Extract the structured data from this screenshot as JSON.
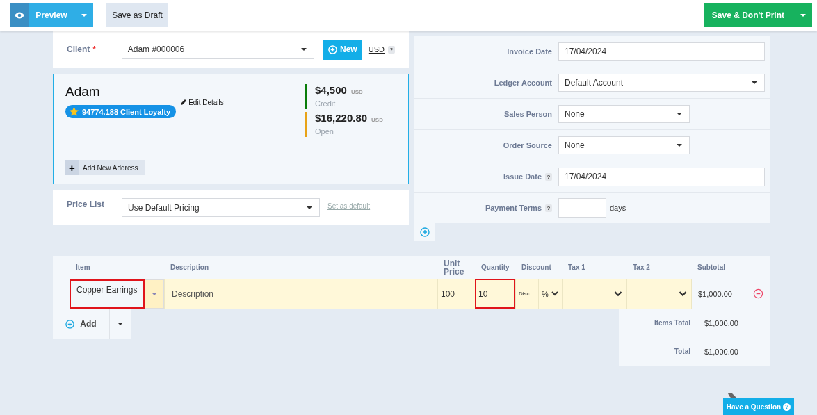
{
  "toolbar": {
    "preview_button": "Preview",
    "draft_button": "Save as Draft",
    "save_button": "Save & Don't Print"
  },
  "client": {
    "label": "Client",
    "required_mark": "*",
    "value": "Adam #000006",
    "new_button": "New",
    "currency": "USD",
    "currency_help": "?"
  },
  "client_card": {
    "name": "Adam",
    "edit_link": "Edit Details",
    "loyalty": "94774.188 Client Loyalty",
    "add_address_icon": "+",
    "add_address": "Add New Address",
    "balances": [
      {
        "amount": "$4,500",
        "currency": "USD",
        "label": "Credit",
        "color": "#0a7d0a"
      },
      {
        "amount": "$16,220.80",
        "currency": "USD",
        "label": "Open",
        "color": "#e8a317"
      }
    ]
  },
  "price_list": {
    "label": "Price List",
    "value": "Use Default Pricing",
    "link": "Set as default"
  },
  "fields": [
    {
      "label": "Invoice Date",
      "kind": "date",
      "value": "17/04/2024"
    },
    {
      "label": "Ledger Account",
      "kind": "account",
      "value": "Default Account"
    },
    {
      "label": "Sales Person",
      "kind": "select",
      "value": "None"
    },
    {
      "label": "Order Source",
      "kind": "select",
      "value": "None"
    },
    {
      "label": "Issue Date",
      "kind": "date",
      "value": "17/04/2024",
      "help": "?"
    },
    {
      "label": "Payment Terms",
      "kind": "number",
      "suffix": "days",
      "help": "?"
    }
  ],
  "items_table": {
    "columns": [
      "Item",
      "Description",
      "Unit Price",
      "Quantity",
      "Discount",
      "Tax 1",
      "Tax 2",
      "Subtotal"
    ],
    "rows": [
      {
        "item": "Copper Earrings",
        "item_highlighted": true,
        "description_placeholder": "Description",
        "unit_price": "100",
        "quantity": "10",
        "quantity_highlighted": true,
        "discount_placeholder": "Disc.",
        "discount_type": "%",
        "subtotal": "$1,000.00"
      }
    ]
  },
  "add_button": "Add",
  "totals": [
    {
      "label": "Items Total",
      "value": "$1,000.00"
    },
    {
      "label": "Total",
      "value": "$1,000.00"
    }
  ],
  "help_button": "Have a Question",
  "help_button_icon": "?"
}
